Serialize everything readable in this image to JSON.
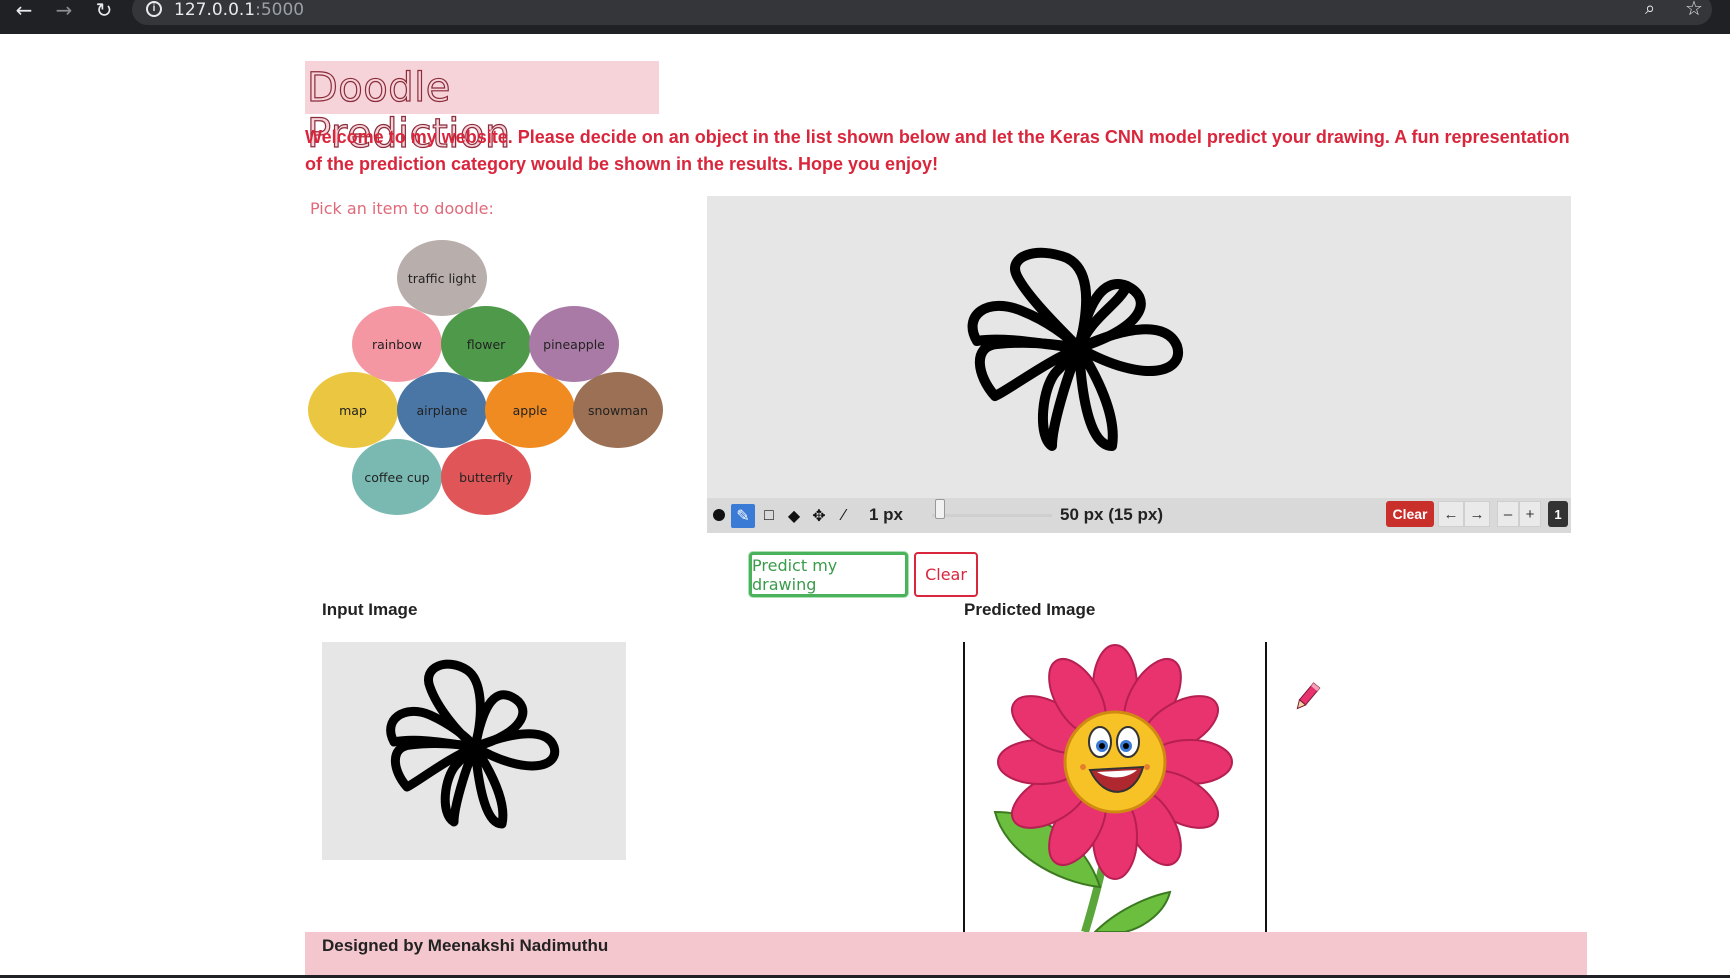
{
  "browser": {
    "url_host": "127.0.0.1",
    "url_port": ":5000"
  },
  "page": {
    "title": "Doodle Prediction",
    "intro": "Welcome to my website. Please decide on an object in the list shown below and let the Keras CNN model predict your drawing. A fun representation of the prediction category would be shown in the results. Hope you enjoy!",
    "pick_label": "Pick an item to doodle:"
  },
  "items": [
    {
      "label": "traffic light",
      "color": "#b8aeac"
    },
    {
      "label": "rainbow",
      "color": "#f597a3"
    },
    {
      "label": "flower",
      "color": "#4e9a4a"
    },
    {
      "label": "pineapple",
      "color": "#a97aa6"
    },
    {
      "label": "map",
      "color": "#ebc640"
    },
    {
      "label": "airplane",
      "color": "#4a76a6"
    },
    {
      "label": "apple",
      "color": "#f08b22"
    },
    {
      "label": "snowman",
      "color": "#9b7054"
    },
    {
      "label": "coffee cup",
      "color": "#79b9b2"
    },
    {
      "label": "butterfly",
      "color": "#e05658"
    }
  ],
  "canvas_toolbar": {
    "stroke_size": "1 px",
    "brush_size": "50 px (15 px)",
    "clear_label": "Clear",
    "undo": "←",
    "redo": "→",
    "zoom_out": "–",
    "zoom_in": "+",
    "layer": "1"
  },
  "actions": {
    "predict_label": "Predict my drawing",
    "clear_label": "Clear"
  },
  "results": {
    "input_title": "Input Image",
    "predicted_title": "Predicted Image"
  },
  "footer": {
    "text": "Designed by Meenakshi Nadimuthu"
  }
}
